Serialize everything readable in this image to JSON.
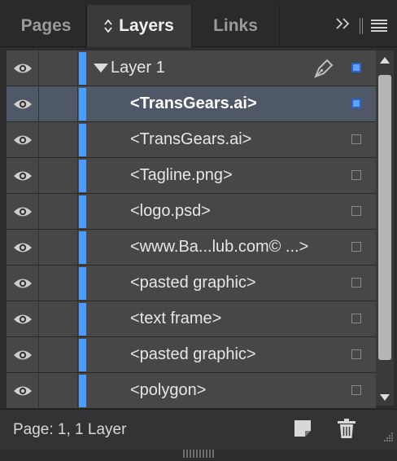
{
  "tabs": [
    {
      "label": "Pages",
      "active": false
    },
    {
      "label": "Layers",
      "active": true
    },
    {
      "label": "Links",
      "active": false
    }
  ],
  "layer": {
    "name": "Layer 1",
    "expanded": true,
    "color": "#4a9eff"
  },
  "items": [
    {
      "name": "<TransGears.ai>",
      "selected": true
    },
    {
      "name": "<TransGears.ai>",
      "selected": false
    },
    {
      "name": "<Tagline.png>",
      "selected": false
    },
    {
      "name": "<logo.psd>",
      "selected": false
    },
    {
      "name": "<www.Ba...lub.com© ...>",
      "selected": false
    },
    {
      "name": "<pasted graphic>",
      "selected": false
    },
    {
      "name": "<text frame>",
      "selected": false
    },
    {
      "name": "<pasted graphic>",
      "selected": false
    },
    {
      "name": "<polygon>",
      "selected": false
    }
  ],
  "footer": {
    "status": "Page: 1, 1 Layer"
  },
  "icons": {
    "eye": "eye-icon",
    "pen": "pen-nib-icon",
    "new_layer": "new-layer-icon",
    "trash": "trash-icon",
    "panel_menu": "hamburger-menu-icon",
    "collapse": "double-chevron-right-icon"
  },
  "colors": {
    "layer_color": "#4a9eff",
    "selection": "#5fa0ff",
    "selected_row": "#4f5866"
  }
}
